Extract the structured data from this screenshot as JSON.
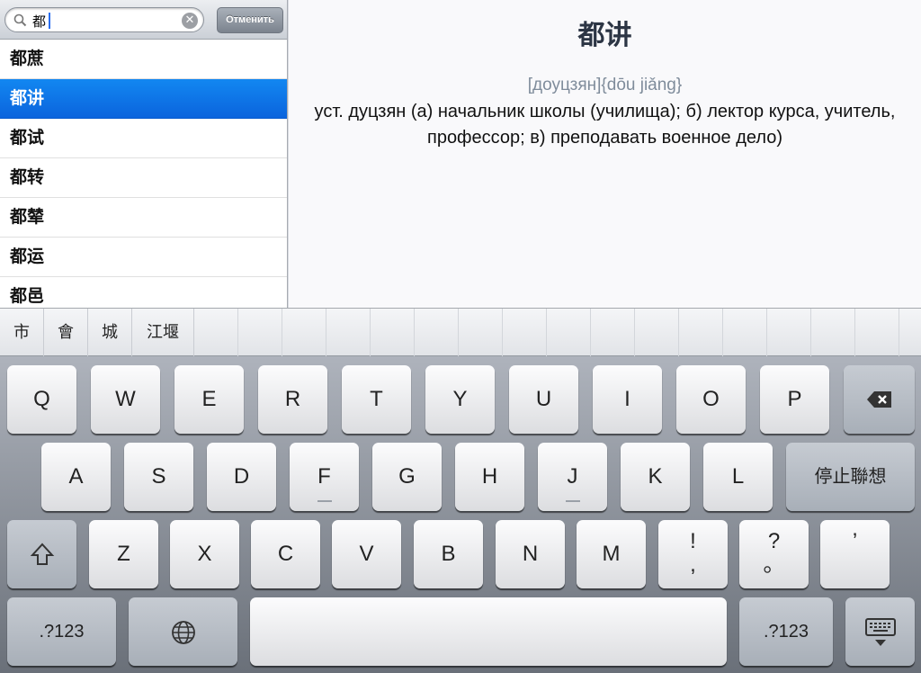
{
  "search": {
    "value": "都",
    "placeholder": "",
    "cancel_label": "Отменить"
  },
  "results": [
    "都蔗",
    "都讲",
    "都试",
    "都转",
    "都辇",
    "都运",
    "都邑"
  ],
  "selected_index": 1,
  "entry": {
    "title": "都讲",
    "transcription": "[доуцзян]{dōu jiǎng}",
    "definition": "уст. дуцзян (а) начальник школы (училища); б) лектор курса, учитель, профессор; в) преподавать военное дело)"
  },
  "candidates": [
    "市",
    "會",
    "城",
    "江堰"
  ],
  "keyboard": {
    "row1": [
      "Q",
      "W",
      "E",
      "R",
      "T",
      "Y",
      "U",
      "I",
      "O",
      "P"
    ],
    "row2": [
      "A",
      "S",
      "D",
      "F",
      "G",
      "H",
      "J",
      "K",
      "L"
    ],
    "row2_action": "停止聯想",
    "row3": [
      "Z",
      "X",
      "C",
      "V",
      "B",
      "N",
      "M"
    ],
    "punct": [
      {
        "top": "!",
        "bottom": ","
      },
      {
        "top": "?",
        "bottom": "。"
      },
      {
        "top": "’",
        "bottom": ""
      }
    ],
    "numbers_label": ".?123",
    "icons": {
      "backspace": "backspace-icon",
      "shift": "shift-icon",
      "globe": "globe-icon",
      "dismiss": "keyboard-dismiss-icon",
      "search": "search-icon",
      "clear": "clear-icon"
    }
  },
  "colors": {
    "selection": "#0b6fe6",
    "title": "#2c3544",
    "transcription": "#7f8c9b"
  }
}
